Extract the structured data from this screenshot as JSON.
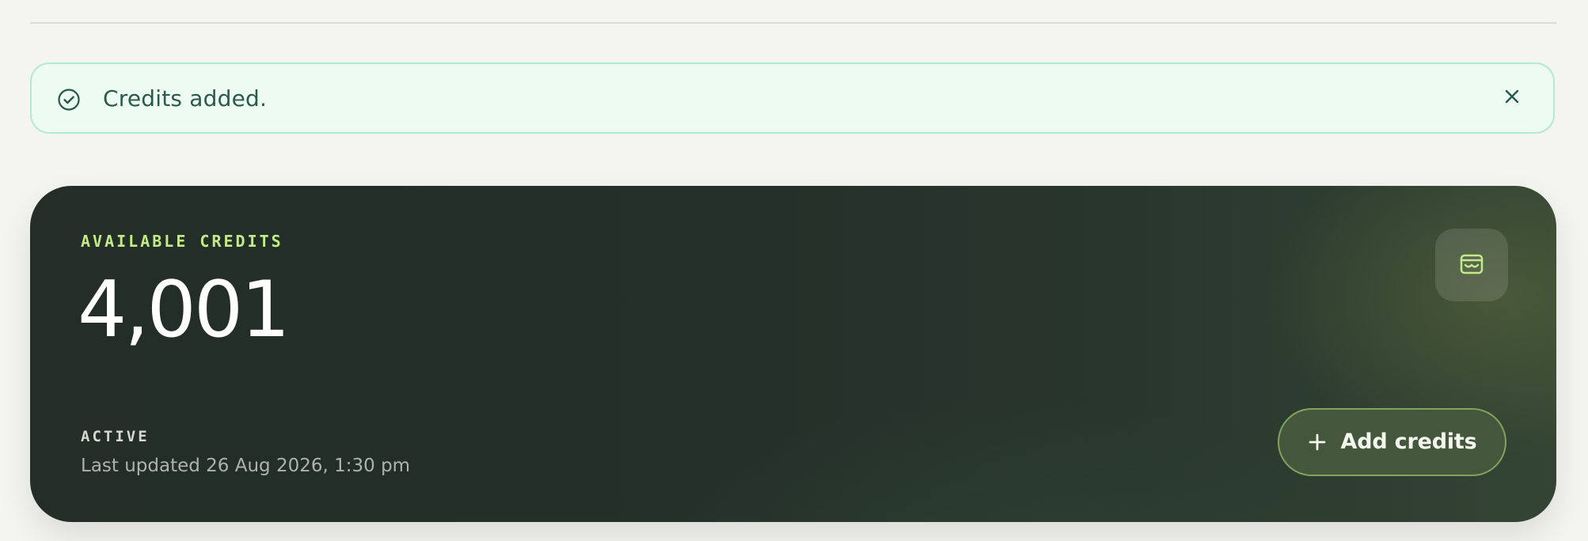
{
  "notification": {
    "message": "Credits added.",
    "icon": "check-circle-icon",
    "close_icon": "close-icon",
    "accent_color": "#2a5b49",
    "background_color": "#edfbf3",
    "border_color": "#b6ead0"
  },
  "credits_card": {
    "eyebrow": "AVAILABLE CREDITS",
    "value": "4,001",
    "status": "ACTIVE",
    "last_updated": "Last updated 26 Aug 2026, 1:30 pm",
    "wallet_icon": "wallet-icon",
    "button": {
      "label": "Add credits",
      "icon": "plus-icon"
    },
    "colors": {
      "background_start": "#242d27",
      "background_end": "#344434",
      "eyebrow": "#c2eb86",
      "value": "#ffffff",
      "status": "#d6d8d1",
      "meta": "#aeb3ab",
      "button_bg": "#44563b",
      "button_border": "#81a45d"
    }
  }
}
